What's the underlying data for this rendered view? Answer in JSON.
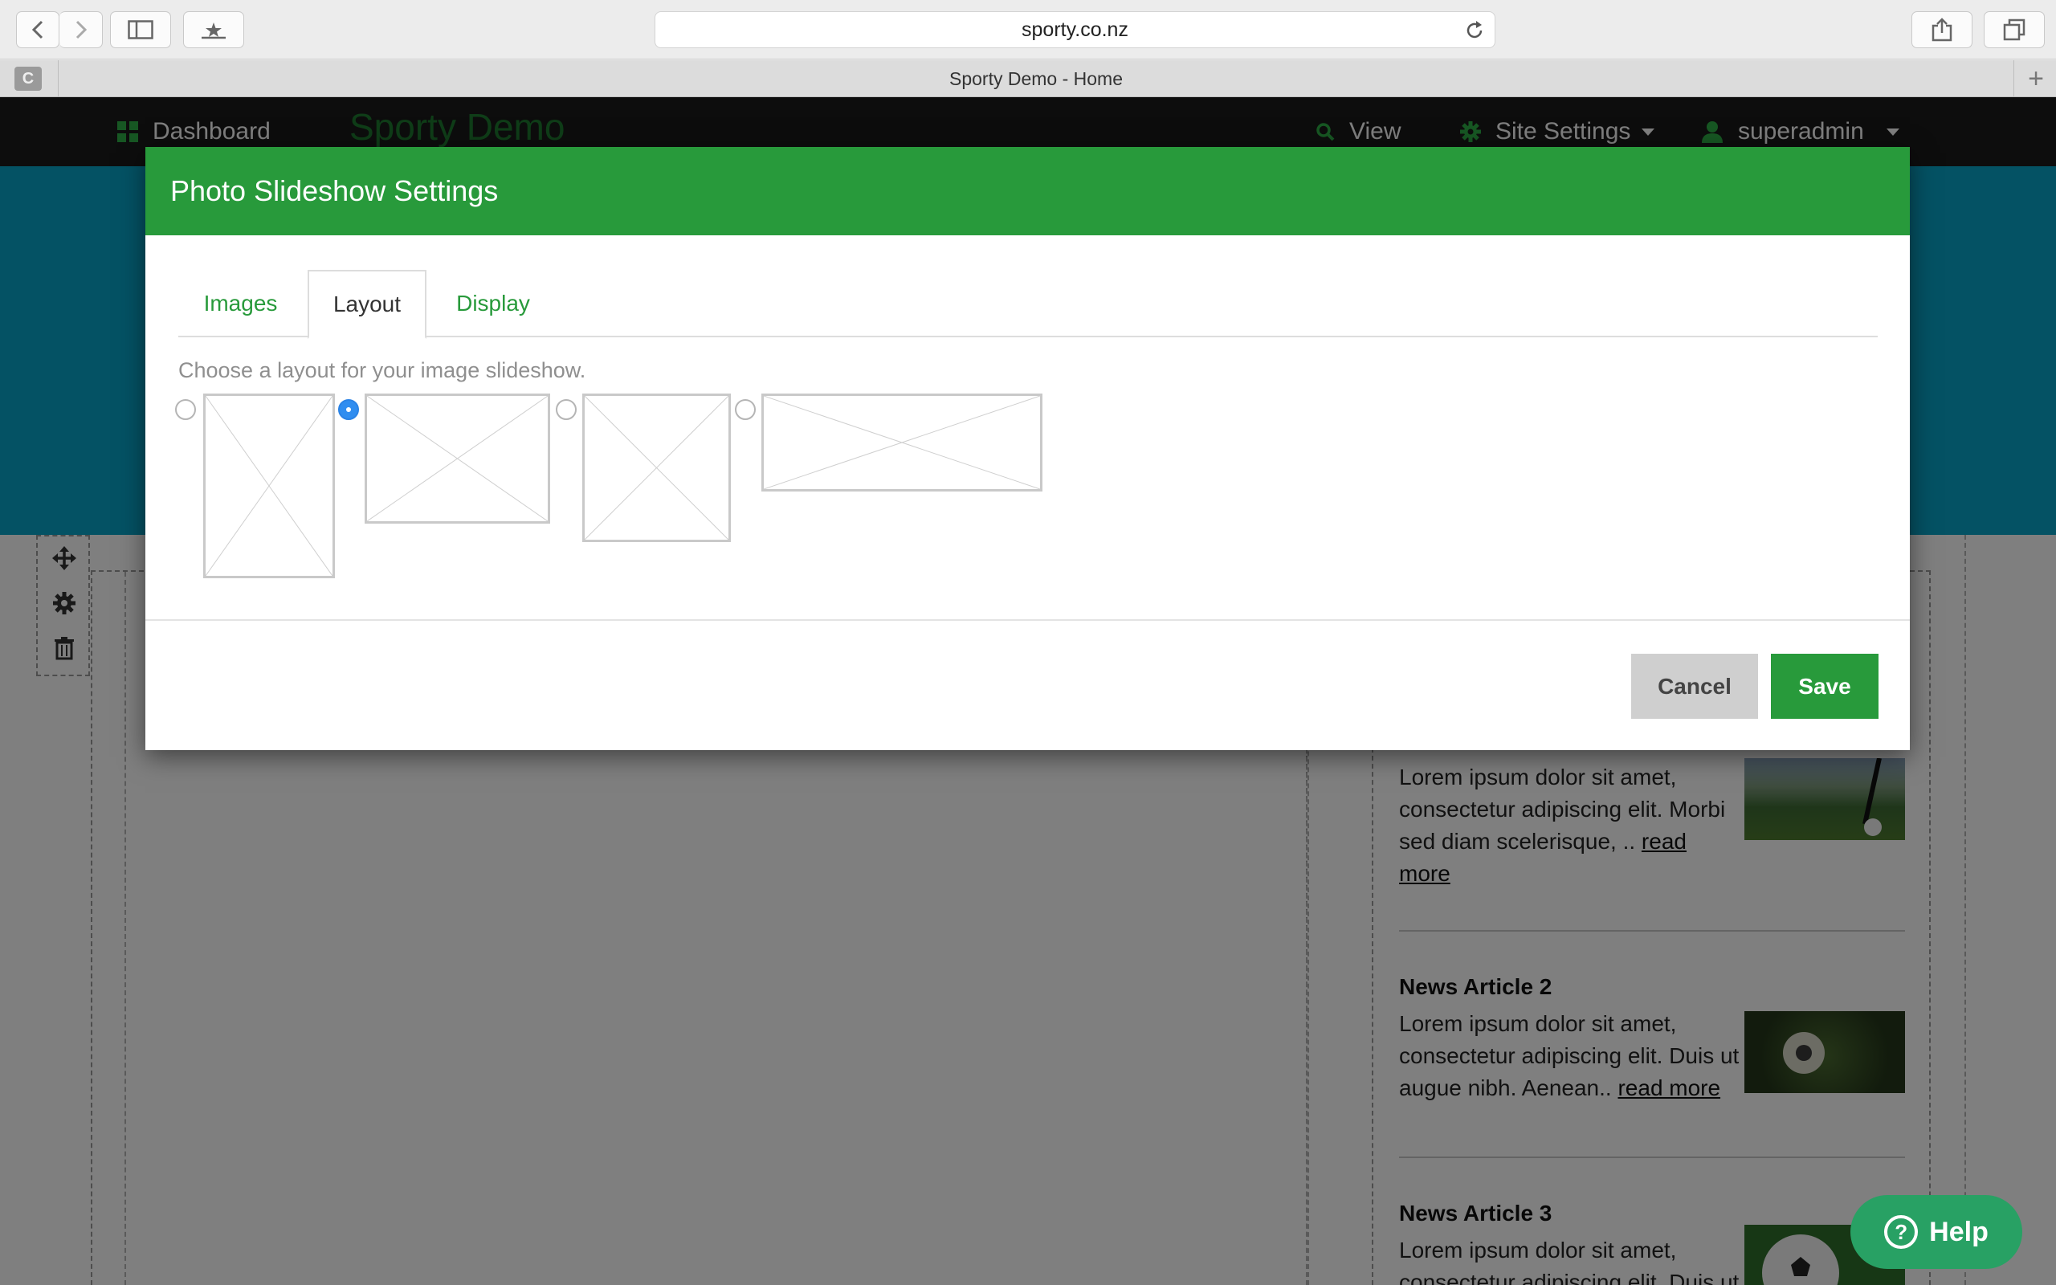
{
  "browser": {
    "url": "sporty.co.nz",
    "tab_title": "Sporty Demo - Home",
    "tab_favicon_letter": "C",
    "new_tab_symbol": "+"
  },
  "site_nav": {
    "dashboard_label": "Dashboard",
    "brand": "Sporty Demo",
    "view_label": "View",
    "site_settings_label": "Site Settings",
    "user_label": "superadmin"
  },
  "articles": [
    {
      "title": "",
      "text": "Lorem ipsum dolor sit amet, consectetur adipiscing elit. Morbi sed diam scelerisque, .. ",
      "read_more": "read more"
    },
    {
      "title": "News Article 2",
      "text": "Lorem ipsum dolor sit amet, consectetur adipiscing elit. Duis ut augue nibh. Aenean.. ",
      "read_more": "read more"
    },
    {
      "title": "News Article 3",
      "text": "Lorem ipsum dolor sit amet, consectetur adipiscing elit. Duis ut",
      "read_more": ""
    }
  ],
  "modal": {
    "title": "Photo Slideshow Settings",
    "tabs": [
      "Images",
      "Layout",
      "Display"
    ],
    "active_tab": "Layout",
    "hint": "Choose a layout for your image slideshow.",
    "layout_options": [
      {
        "shape": "portrait",
        "selected": false
      },
      {
        "shape": "landscape",
        "selected": true
      },
      {
        "shape": "square",
        "selected": false
      },
      {
        "shape": "wide",
        "selected": false
      }
    ],
    "cancel_label": "Cancel",
    "save_label": "Save"
  },
  "help": {
    "label": "Help",
    "icon": "?"
  },
  "colors": {
    "brand_green": "#289a3b",
    "banner_cyan": "#08a5c8",
    "nav_dark": "#1b1b1b",
    "radio_blue": "#2f8df0",
    "help_green": "#28a164"
  }
}
